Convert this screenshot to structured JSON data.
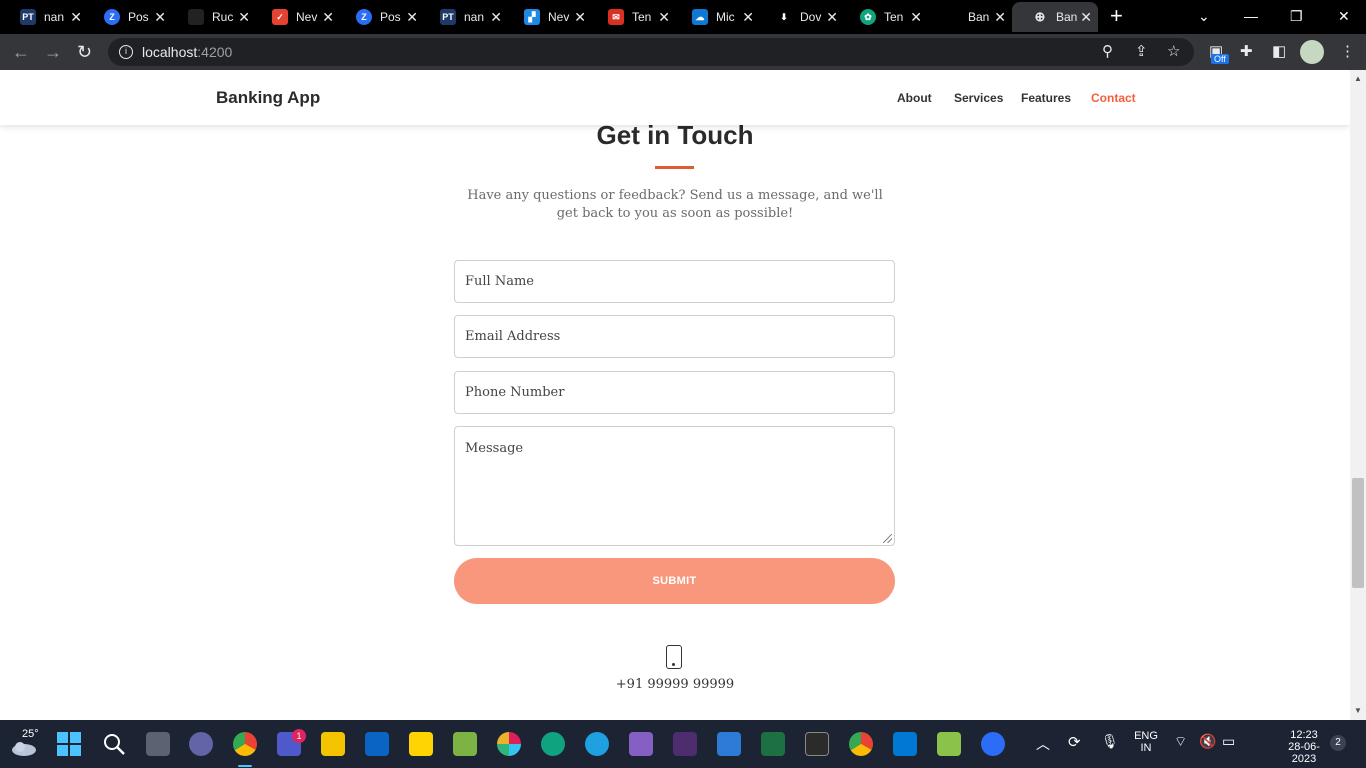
{
  "browser": {
    "tabs": [
      {
        "title": "nan",
        "icon": "pt-icon",
        "color": "#1f3a68",
        "glyph": "PT"
      },
      {
        "title": "Pos",
        "icon": "zoho-z-icon",
        "color": "#2b6df6",
        "glyph": "Z"
      },
      {
        "title": "Ruc",
        "icon": "site-icon",
        "color": "#222222",
        "glyph": ""
      },
      {
        "title": "Nev",
        "icon": "todoist-icon",
        "color": "#e44332",
        "glyph": "✓"
      },
      {
        "title": "Pos",
        "icon": "zoho-z-icon",
        "color": "#2b6df6",
        "glyph": "Z"
      },
      {
        "title": "nan",
        "icon": "pt-icon",
        "color": "#1f3a68",
        "glyph": "PT"
      },
      {
        "title": "Nev",
        "icon": "grid-icon",
        "color": "#1e88e5",
        "glyph": "▞"
      },
      {
        "title": "Ten",
        "icon": "mail-icon",
        "color": "#d93025",
        "glyph": "✉"
      },
      {
        "title": "Mic",
        "icon": "onedrive-icon",
        "color": "#0f78d4",
        "glyph": "☁"
      },
      {
        "title": "Dov",
        "icon": "download-icon",
        "color": "#000000",
        "glyph": "⬇"
      },
      {
        "title": "Ten",
        "icon": "openai-icon",
        "color": "#10a37f",
        "glyph": "✿"
      },
      {
        "title": "Ban",
        "icon": "blank-icon",
        "color": "#000000",
        "glyph": ""
      },
      {
        "title": "Ban",
        "icon": "globe-icon",
        "color": "#35363a",
        "glyph": "🌐"
      }
    ],
    "url": {
      "host": "localhost",
      "port": ":4200"
    },
    "extension_badge": "Off"
  },
  "site": {
    "brand": "Banking App",
    "nav": [
      {
        "label": "About",
        "active": false
      },
      {
        "label": "Services",
        "active": false
      },
      {
        "label": "Features",
        "active": false
      },
      {
        "label": "Contact",
        "active": true
      }
    ],
    "accent_color": "#f2613f"
  },
  "contact": {
    "title": "Get in Touch",
    "subtitle": "Have any questions or feedback? Send us a message, and we'll get back to you as soon as possible!",
    "fields": {
      "name_placeholder": "Full Name",
      "email_placeholder": "Email Address",
      "phone_placeholder": "Phone Number",
      "message_placeholder": "Message"
    },
    "submit_label": "SUBMIT",
    "submit_color": "#f8977c",
    "phone": "+91 99999 99999"
  },
  "taskbar": {
    "temperature": "25°",
    "teams_badge": "1",
    "language": "ENG",
    "region": "IN",
    "time": "12:23",
    "date": "28-06-2023",
    "notifications": "2"
  }
}
